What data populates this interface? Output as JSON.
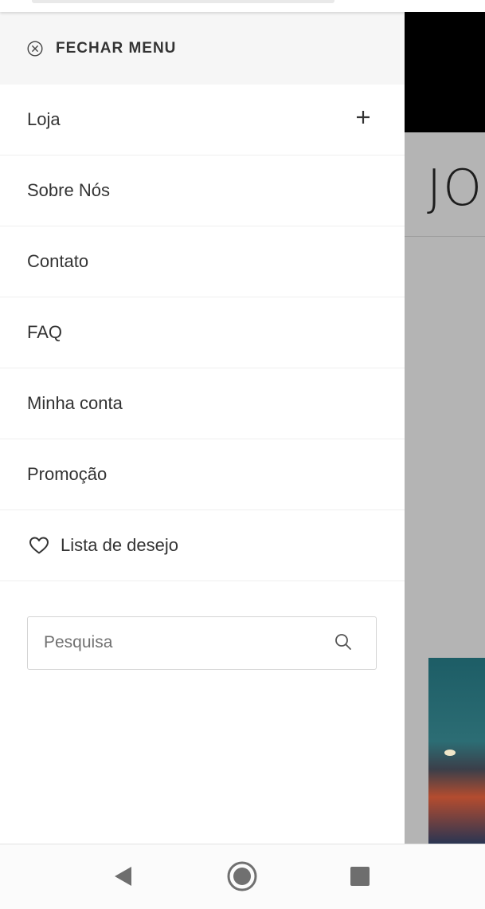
{
  "drawer": {
    "close_label": "FECHAR MENU",
    "items": [
      {
        "label": "Loja"
      },
      {
        "label": "Sobre Nós"
      },
      {
        "label": "Contato"
      },
      {
        "label": "FAQ"
      },
      {
        "label": "Minha conta"
      },
      {
        "label": "Promoção"
      },
      {
        "label": "Lista de desejo"
      }
    ]
  },
  "search": {
    "placeholder": "Pesquisa",
    "value": ""
  },
  "background_page": {
    "logo_text": "JO"
  },
  "colors": {
    "drawer_bg": "#ffffff",
    "close_row_bg": "#f6f6f6",
    "overlay_bg": "#b4b4b4",
    "header_black": "#000000"
  },
  "icons": {
    "close": "circle-x-icon",
    "expand": "plus-icon",
    "wishlist": "heart-icon",
    "search": "search-icon",
    "nav_back": "triangle-back-icon",
    "nav_home": "circle-home-icon",
    "nav_recents": "square-recents-icon"
  }
}
